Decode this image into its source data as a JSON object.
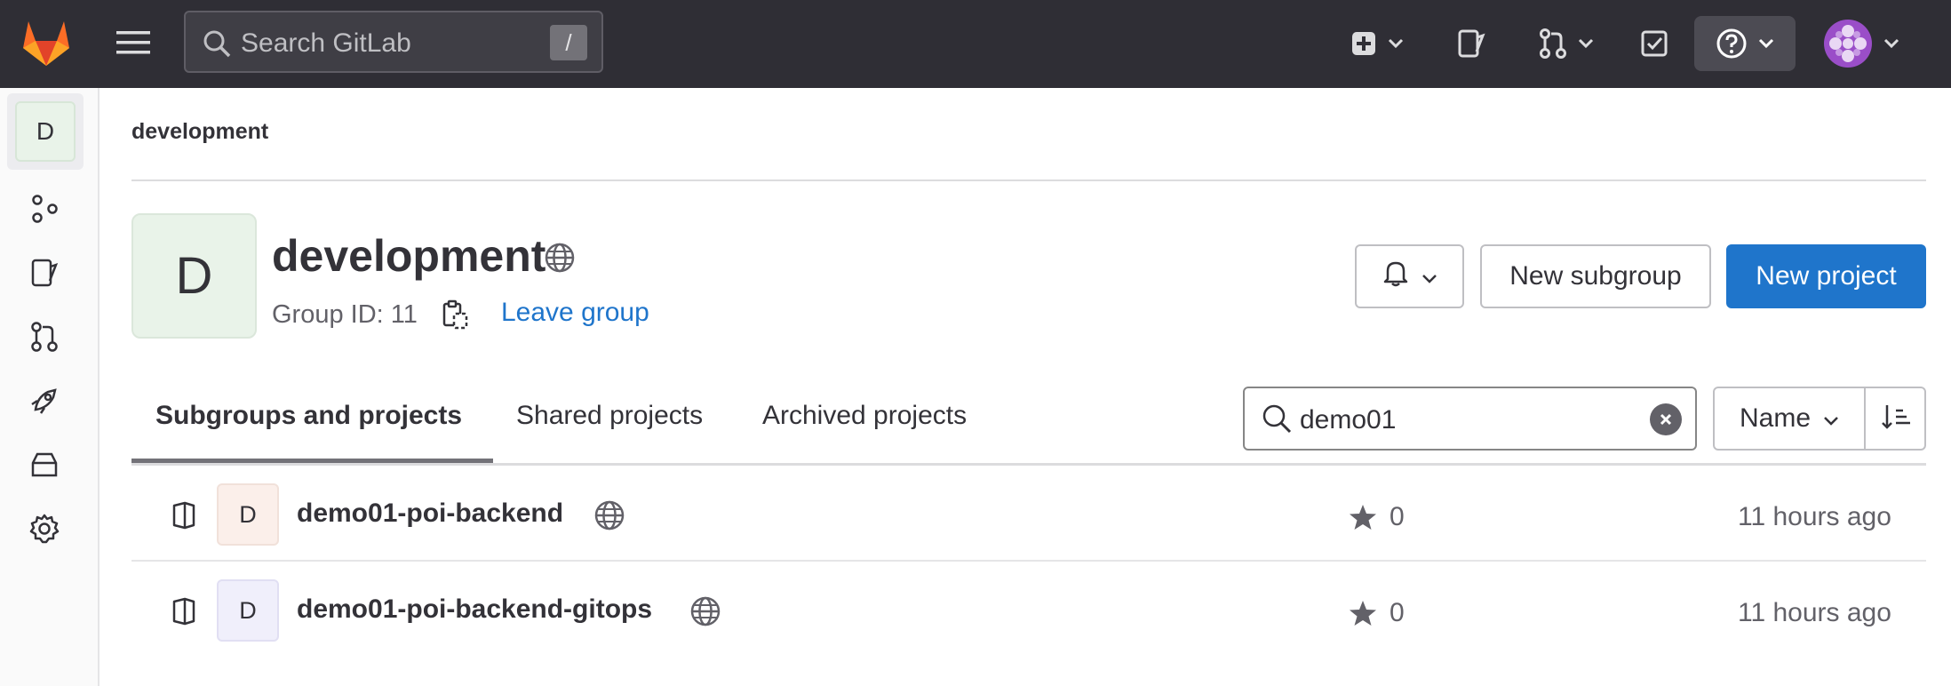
{
  "topbar": {
    "search_placeholder": "Search GitLab",
    "search_shortcut": "/"
  },
  "sidebar": {
    "group_initial": "D"
  },
  "breadcrumb": "development",
  "group": {
    "initial": "D",
    "name": "development",
    "id_label": "Group ID: 11",
    "leave_label": "Leave group"
  },
  "actions": {
    "new_subgroup": "New subgroup",
    "new_project": "New project"
  },
  "tabs": [
    {
      "label": "Subgroups and projects",
      "active": true
    },
    {
      "label": "Shared projects",
      "active": false
    },
    {
      "label": "Archived projects",
      "active": false
    }
  ],
  "filter": {
    "value": "demo01"
  },
  "sort": {
    "label": "Name"
  },
  "projects": [
    {
      "initial": "D",
      "name": "demo01-poi-backend",
      "stars": "0",
      "updated": "11 hours ago"
    },
    {
      "initial": "D",
      "name": "demo01-poi-backend-gitops",
      "stars": "0",
      "updated": "11 hours ago"
    }
  ],
  "colors": {
    "topbar": "#2f2e35",
    "primary": "#1f75cb",
    "logo_orange": "#fc6d26"
  }
}
